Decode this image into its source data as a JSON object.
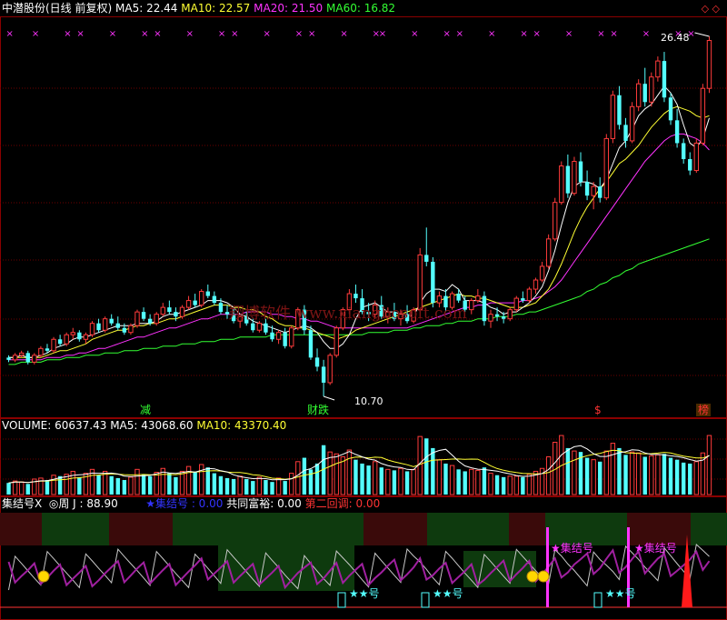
{
  "colors": {
    "up": "#ff3b3b",
    "down": "#54ffff",
    "ma5": "#ffffff",
    "ma10": "#ffff33",
    "ma20": "#ff33ff",
    "ma60": "#33ff33",
    "frame": "#8b0000",
    "grid": "#6b0000",
    "jlz_blue": "#3333ff",
    "jlz_white": "#ffffff",
    "gyfy": "#ffffff",
    "derh": "#ff3333",
    "week_j": "#ffffff"
  },
  "header": {
    "title": "中潜股份(日线 前复权)",
    "ma5": "MA5: 22.44",
    "ma10": "MA10: 22.57",
    "ma20": "MA20: 21.50",
    "ma60": "MA60: 16.82"
  },
  "price_panel": {
    "high_label": "26.48",
    "low_label": "10.70",
    "watermark": "翔博软件 www.xiangbosoft.com",
    "tags": [
      {
        "text": "减",
        "color": "#33ff33"
      },
      {
        "text": "财跌",
        "color": "#33ff33"
      },
      {
        "text": "$",
        "color": "#ff3333"
      },
      {
        "text": "榜",
        "color": "#ff3333"
      }
    ],
    "x_marks_count": 28
  },
  "volume_panel": {
    "volume": "VOLUME: 60637.43",
    "ma5": "MA5: 43068.60",
    "ma10": "MA10: 43370.40"
  },
  "indicator_panel": {
    "name": "集结号X",
    "week_j": "◎周 J : 88.90",
    "jlz": "★集结号 : 0.00",
    "gyfy": "共同富裕: 0.00",
    "derh": "第二回调: 0.00",
    "signal_jlz": "★集结号",
    "signal_stars": "★★号"
  },
  "chart_data": {
    "type": "candlestick",
    "price_range": [
      10.7,
      26.48
    ],
    "candles": [
      [
        12.4,
        12.5,
        12.2,
        12.3
      ],
      [
        12.3,
        12.6,
        12.2,
        12.5
      ],
      [
        12.5,
        12.7,
        12.4,
        12.6
      ],
      [
        12.6,
        12.7,
        12.1,
        12.2
      ],
      [
        12.2,
        12.6,
        12.1,
        12.5
      ],
      [
        12.5,
        12.9,
        12.4,
        12.8
      ],
      [
        12.8,
        13.0,
        12.6,
        12.7
      ],
      [
        12.7,
        13.3,
        12.6,
        13.2
      ],
      [
        13.2,
        13.4,
        12.9,
        13.0
      ],
      [
        13.0,
        13.5,
        12.9,
        13.4
      ],
      [
        13.4,
        13.7,
        13.2,
        13.5
      ],
      [
        13.5,
        13.6,
        13.1,
        13.2
      ],
      [
        13.2,
        13.5,
        13.0,
        13.4
      ],
      [
        13.4,
        14.0,
        13.3,
        13.9
      ],
      [
        13.9,
        14.1,
        13.5,
        13.6
      ],
      [
        13.6,
        14.2,
        13.5,
        14.1
      ],
      [
        14.1,
        14.3,
        13.8,
        13.9
      ],
      [
        13.9,
        14.2,
        13.6,
        13.7
      ],
      [
        13.7,
        13.9,
        13.4,
        13.5
      ],
      [
        13.5,
        13.9,
        13.4,
        13.8
      ],
      [
        13.8,
        14.5,
        13.7,
        14.4
      ],
      [
        14.4,
        14.6,
        14.0,
        14.1
      ],
      [
        14.1,
        14.3,
        13.8,
        13.9
      ],
      [
        13.9,
        14.4,
        13.8,
        14.3
      ],
      [
        14.3,
        14.8,
        14.2,
        14.6
      ],
      [
        14.6,
        14.9,
        14.3,
        14.4
      ],
      [
        14.4,
        14.6,
        14.0,
        14.2
      ],
      [
        14.2,
        14.7,
        14.1,
        14.6
      ],
      [
        14.6,
        15.1,
        14.5,
        14.9
      ],
      [
        14.9,
        15.2,
        14.6,
        14.7
      ],
      [
        14.7,
        15.4,
        14.6,
        15.3
      ],
      [
        15.3,
        15.6,
        15.0,
        15.1
      ],
      [
        15.1,
        15.3,
        14.7,
        14.8
      ],
      [
        14.8,
        15.0,
        14.3,
        14.4
      ],
      [
        14.4,
        14.7,
        14.1,
        14.3
      ],
      [
        14.3,
        14.6,
        13.9,
        14.0
      ],
      [
        14.0,
        14.3,
        13.7,
        14.2
      ],
      [
        14.2,
        14.4,
        13.8,
        13.9
      ],
      [
        13.9,
        14.1,
        13.5,
        13.6
      ],
      [
        13.6,
        14.0,
        13.5,
        13.9
      ],
      [
        13.9,
        14.1,
        13.4,
        13.5
      ],
      [
        13.5,
        13.8,
        13.1,
        13.2
      ],
      [
        13.2,
        13.6,
        13.0,
        13.5
      ],
      [
        13.5,
        13.7,
        12.8,
        12.9
      ],
      [
        12.9,
        13.8,
        12.8,
        13.7
      ],
      [
        13.7,
        14.6,
        13.6,
        14.5
      ],
      [
        14.5,
        14.7,
        13.4,
        13.6
      ],
      [
        13.6,
        13.8,
        12.3,
        12.4
      ],
      [
        12.4,
        12.8,
        11.8,
        12.0
      ],
      [
        12.0,
        12.3,
        10.7,
        11.3
      ],
      [
        11.3,
        12.6,
        11.2,
        12.5
      ],
      [
        12.5,
        13.8,
        12.4,
        13.7
      ],
      [
        13.7,
        14.6,
        13.6,
        14.5
      ],
      [
        14.5,
        15.4,
        14.3,
        15.2
      ],
      [
        15.2,
        15.6,
        14.8,
        15.0
      ],
      [
        15.0,
        15.4,
        14.3,
        14.4
      ],
      [
        14.4,
        14.8,
        14.0,
        14.3
      ],
      [
        14.3,
        14.9,
        14.1,
        14.7
      ],
      [
        14.7,
        15.1,
        14.1,
        14.2
      ],
      [
        14.2,
        14.6,
        13.9,
        14.4
      ],
      [
        14.4,
        14.8,
        14.0,
        14.1
      ],
      [
        14.1,
        14.5,
        13.8,
        14.3
      ],
      [
        14.3,
        14.7,
        13.9,
        14.0
      ],
      [
        14.0,
        14.6,
        13.9,
        14.5
      ],
      [
        14.5,
        17.2,
        14.4,
        16.9
      ],
      [
        16.9,
        18.1,
        16.4,
        16.6
      ],
      [
        16.6,
        16.8,
        14.6,
        14.8
      ],
      [
        14.8,
        15.3,
        14.6,
        15.1
      ],
      [
        15.1,
        15.4,
        14.4,
        14.6
      ],
      [
        14.6,
        15.3,
        14.5,
        15.2
      ],
      [
        15.2,
        15.4,
        14.8,
        14.9
      ],
      [
        14.9,
        15.1,
        14.4,
        14.5
      ],
      [
        14.5,
        15.0,
        14.3,
        14.9
      ],
      [
        14.9,
        15.4,
        14.8,
        15.1
      ],
      [
        15.1,
        15.3,
        13.8,
        14.0
      ],
      [
        14.0,
        14.5,
        13.7,
        14.3
      ],
      [
        14.3,
        14.6,
        14.0,
        14.2
      ],
      [
        14.2,
        14.4,
        13.9,
        14.1
      ],
      [
        14.1,
        14.6,
        14.0,
        14.5
      ],
      [
        14.5,
        15.1,
        14.4,
        15.0
      ],
      [
        15.0,
        15.3,
        14.8,
        14.9
      ],
      [
        14.9,
        15.5,
        14.8,
        15.4
      ],
      [
        15.4,
        15.9,
        15.2,
        15.8
      ],
      [
        15.8,
        16.6,
        15.7,
        16.4
      ],
      [
        16.4,
        17.8,
        16.3,
        17.6
      ],
      [
        17.6,
        19.4,
        17.5,
        19.2
      ],
      [
        19.2,
        21.0,
        19.1,
        20.8
      ],
      [
        20.8,
        21.3,
        19.4,
        19.6
      ],
      [
        19.6,
        21.2,
        19.5,
        21.0
      ],
      [
        21.0,
        21.4,
        19.9,
        20.1
      ],
      [
        20.1,
        20.6,
        19.3,
        19.5
      ],
      [
        19.5,
        20.1,
        18.9,
        19.9
      ],
      [
        19.9,
        20.3,
        19.2,
        19.4
      ],
      [
        19.4,
        22.2,
        19.3,
        22.0
      ],
      [
        22.0,
        24.1,
        21.8,
        23.9
      ],
      [
        23.9,
        24.3,
        22.4,
        22.6
      ],
      [
        22.6,
        22.9,
        21.6,
        21.9
      ],
      [
        21.9,
        23.6,
        21.8,
        23.4
      ],
      [
        23.4,
        24.6,
        23.2,
        24.4
      ],
      [
        24.4,
        25.1,
        23.4,
        23.6
      ],
      [
        23.6,
        24.9,
        23.4,
        24.7
      ],
      [
        24.7,
        25.6,
        24.5,
        25.4
      ],
      [
        25.4,
        25.8,
        23.6,
        23.8
      ],
      [
        23.8,
        24.0,
        22.6,
        22.8
      ],
      [
        22.8,
        23.3,
        21.6,
        21.8
      ],
      [
        21.8,
        22.0,
        20.9,
        21.1
      ],
      [
        21.1,
        21.4,
        20.4,
        20.6
      ],
      [
        20.6,
        22.0,
        20.5,
        21.8
      ],
      [
        21.8,
        24.4,
        21.7,
        24.2
      ],
      [
        24.2,
        26.48,
        24.0,
        26.3
      ]
    ],
    "ma5": [
      12.4,
      12.4,
      12.5,
      12.4,
      12.4,
      12.5,
      12.6,
      12.8,
      12.9,
      13.0,
      13.2,
      13.3,
      13.3,
      13.4,
      13.5,
      13.6,
      13.7,
      13.8,
      13.8,
      13.8,
      13.9,
      13.9,
      13.9,
      14.0,
      14.2,
      14.3,
      14.3,
      14.4,
      14.5,
      14.6,
      14.7,
      14.9,
      14.9,
      14.9,
      14.8,
      14.6,
      14.3,
      14.2,
      14.0,
      13.9,
      13.8,
      13.7,
      13.6,
      13.5,
      13.6,
      13.7,
      13.8,
      13.7,
      13.5,
      13.1,
      12.8,
      12.8,
      13.0,
      13.4,
      14.1,
      14.6,
      14.7,
      14.8,
      14.6,
      14.4,
      14.4,
      14.3,
      14.3,
      14.2,
      14.8,
      15.2,
      15.4,
      15.4,
      15.3,
      15.6,
      15.4,
      14.9,
      14.9,
      14.9,
      14.8,
      14.6,
      14.5,
      14.3,
      14.4,
      14.4,
      14.6,
      14.8,
      15.1,
      15.5,
      16.2,
      17.1,
      18.2,
      19.2,
      19.9,
      20.1,
      20.1,
      20.0,
      19.8,
      20.2,
      20.9,
      21.6,
      21.9,
      22.4,
      23.0,
      23.3,
      23.5,
      23.9,
      24.3,
      24.0,
      23.5,
      22.6,
      21.8,
      21.6,
      22.0,
      22.9
    ],
    "ma10": [
      12.4,
      12.4,
      12.4,
      12.4,
      12.4,
      12.4,
      12.5,
      12.6,
      12.7,
      12.7,
      12.8,
      12.9,
      13.0,
      13.2,
      13.3,
      13.4,
      13.5,
      13.6,
      13.6,
      13.7,
      13.8,
      13.8,
      13.9,
      13.9,
      14.0,
      14.1,
      14.1,
      14.2,
      14.3,
      14.4,
      14.5,
      14.6,
      14.7,
      14.7,
      14.7,
      14.6,
      14.6,
      14.5,
      14.5,
      14.4,
      14.2,
      14.1,
      13.9,
      13.8,
      13.8,
      13.7,
      13.7,
      13.6,
      13.5,
      13.4,
      13.3,
      13.2,
      13.3,
      13.4,
      13.6,
      13.7,
      13.8,
      13.9,
      14.0,
      14.1,
      14.2,
      14.3,
      14.4,
      14.5,
      14.6,
      14.7,
      14.8,
      14.9,
      15.0,
      15.1,
      15.2,
      15.1,
      15.1,
      15.0,
      15.0,
      14.9,
      14.8,
      14.7,
      14.6,
      14.6,
      14.6,
      14.7,
      14.8,
      15.1,
      15.4,
      15.9,
      16.5,
      17.2,
      17.9,
      18.5,
      19.0,
      19.4,
      19.8,
      20.1,
      20.5,
      20.9,
      21.1,
      21.4,
      21.7,
      22.1,
      22.5,
      22.8,
      23.1,
      23.3,
      23.4,
      23.3,
      23.2,
      23.0,
      22.9,
      23.0
    ],
    "ma20": [
      12.3,
      12.3,
      12.3,
      12.3,
      12.3,
      12.3,
      12.4,
      12.4,
      12.4,
      12.5,
      12.5,
      12.6,
      12.6,
      12.7,
      12.8,
      12.8,
      12.9,
      13.0,
      13.1,
      13.2,
      13.3,
      13.3,
      13.4,
      13.5,
      13.6,
      13.7,
      13.7,
      13.8,
      13.9,
      14.0,
      14.1,
      14.1,
      14.2,
      14.3,
      14.3,
      14.3,
      14.3,
      14.4,
      14.4,
      14.4,
      14.4,
      14.3,
      14.3,
      14.2,
      14.2,
      14.1,
      14.1,
      14.0,
      14.0,
      13.9,
      13.8,
      13.7,
      13.7,
      13.7,
      13.7,
      13.7,
      13.7,
      13.7,
      13.7,
      13.7,
      13.7,
      13.7,
      13.7,
      13.8,
      13.9,
      14.0,
      14.1,
      14.2,
      14.3,
      14.4,
      14.5,
      14.6,
      14.6,
      14.7,
      14.7,
      14.8,
      14.8,
      14.8,
      14.8,
      14.8,
      14.9,
      14.9,
      15.0,
      15.1,
      15.3,
      15.5,
      15.8,
      16.2,
      16.6,
      17.0,
      17.4,
      17.8,
      18.2,
      18.6,
      19.0,
      19.4,
      19.8,
      20.2,
      20.6,
      21.0,
      21.3,
      21.6,
      21.9,
      22.1,
      22.2,
      22.2,
      22.1,
      22.0,
      21.8,
      21.5
    ],
    "ma60": [
      12.1,
      12.1,
      12.2,
      12.2,
      12.2,
      12.2,
      12.3,
      12.3,
      12.3,
      12.4,
      12.4,
      12.4,
      12.5,
      12.5,
      12.5,
      12.6,
      12.6,
      12.6,
      12.7,
      12.7,
      12.7,
      12.8,
      12.8,
      12.8,
      12.9,
      12.9,
      12.9,
      13.0,
      13.0,
      13.0,
      13.1,
      13.1,
      13.1,
      13.2,
      13.2,
      13.2,
      13.3,
      13.3,
      13.3,
      13.3,
      13.3,
      13.4,
      13.4,
      13.4,
      13.4,
      13.4,
      13.4,
      13.4,
      13.4,
      13.4,
      13.4,
      13.4,
      13.4,
      13.4,
      13.4,
      13.4,
      13.5,
      13.5,
      13.5,
      13.5,
      13.6,
      13.6,
      13.6,
      13.7,
      13.7,
      13.8,
      13.8,
      13.8,
      13.9,
      13.9,
      14.0,
      14.0,
      14.0,
      14.1,
      14.1,
      14.1,
      14.2,
      14.2,
      14.2,
      14.3,
      14.3,
      14.4,
      14.4,
      14.5,
      14.6,
      14.7,
      14.8,
      14.9,
      15.0,
      15.1,
      15.3,
      15.4,
      15.6,
      15.7,
      15.9,
      16.0,
      16.2,
      16.3,
      16.5,
      16.6,
      16.7,
      16.8,
      16.9,
      17.0,
      17.1,
      17.2,
      17.3,
      17.4,
      17.5,
      17.6
    ],
    "volume": [
      1.2,
      1.4,
      1.3,
      1.1,
      1.6,
      1.7,
      1.5,
      2.0,
      1.9,
      2.1,
      2.4,
      1.8,
      2.2,
      2.6,
      2.0,
      2.4,
      1.9,
      1.7,
      1.5,
      1.8,
      2.6,
      2.1,
      1.9,
      2.3,
      2.7,
      2.2,
      1.8,
      2.4,
      2.9,
      2.3,
      3.1,
      2.8,
      2.2,
      1.9,
      1.7,
      1.6,
      1.9,
      1.6,
      1.4,
      1.8,
      1.5,
      1.3,
      1.7,
      1.4,
      2.2,
      3.4,
      3.8,
      2.6,
      3.2,
      5.1,
      4.4,
      4.2,
      3.9,
      4.6,
      3.6,
      3.2,
      3.0,
      3.4,
      2.8,
      2.6,
      2.5,
      2.7,
      2.4,
      2.6,
      6.0,
      5.8,
      4.8,
      3.6,
      3.2,
      3.0,
      2.6,
      2.4,
      2.6,
      2.5,
      2.8,
      2.2,
      2.0,
      1.8,
      1.9,
      1.9,
      1.8,
      2.1,
      2.4,
      2.7,
      3.9,
      5.4,
      6.1,
      4.8,
      4.5,
      4.4,
      3.8,
      3.6,
      3.4,
      4.5,
      5.3,
      4.8,
      4.1,
      4.4,
      4.3,
      3.9,
      4.0,
      4.1,
      4.2,
      3.8,
      3.6,
      3.3,
      3.2,
      3.4,
      4.3,
      6.1
    ]
  }
}
